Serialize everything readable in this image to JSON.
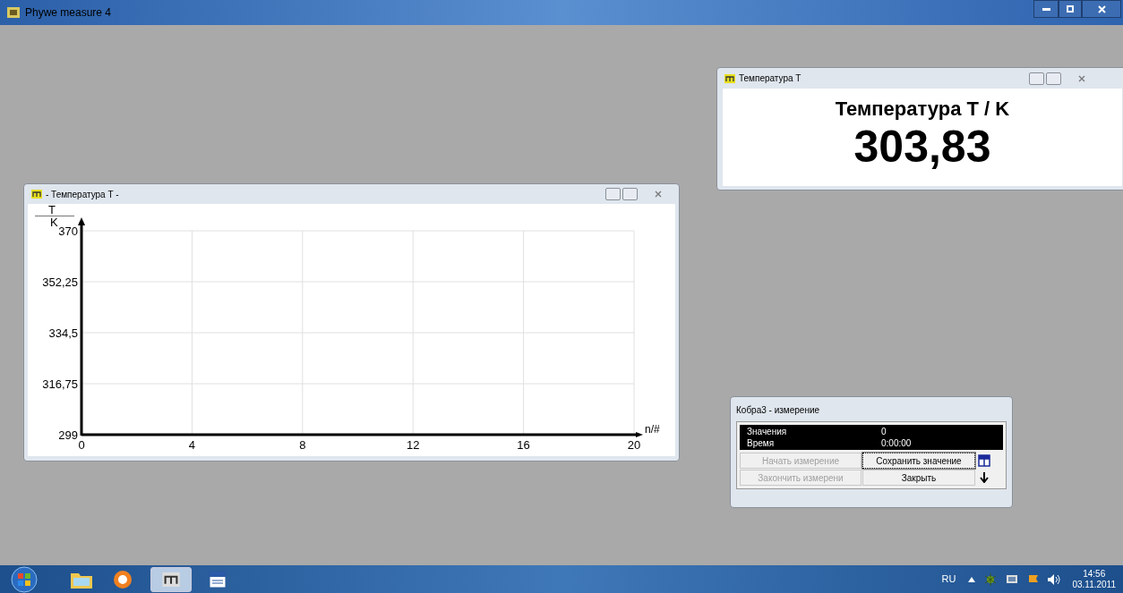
{
  "window": {
    "title": "Phywe measure 4"
  },
  "display_window": {
    "title": "Температура T",
    "heading": "Температура T / K",
    "value": "303,83"
  },
  "chart_window": {
    "title": "- Температура T -",
    "y_quantity": "T",
    "y_unit": "K",
    "chart_data": {
      "type": "line",
      "grid": true,
      "xlabel": "n/#",
      "xlim": [
        0,
        20
      ],
      "ylim": [
        299,
        370
      ],
      "xticks": [
        0,
        4,
        8,
        12,
        16,
        20
      ],
      "yticks": [
        {
          "value": 299,
          "label": "299"
        },
        {
          "value": 316.75,
          "label": "316,75"
        },
        {
          "value": 334.5,
          "label": "334,5"
        },
        {
          "value": 352.25,
          "label": "352,25"
        },
        {
          "value": 370,
          "label": "370"
        }
      ]
    }
  },
  "measure_window": {
    "title": "Кобра3 - измерение",
    "readouts": [
      {
        "label": "Значения",
        "value": "0"
      },
      {
        "label": "Время",
        "value": "0:00:00"
      }
    ],
    "buttons": [
      {
        "label": "Начать измерение",
        "disabled": true,
        "focused": false
      },
      {
        "label": "Сохранить значение",
        "disabled": false,
        "focused": true
      },
      {
        "label": "Закончить измерени",
        "disabled": true,
        "focused": false
      },
      {
        "label": "Закрыть",
        "disabled": false,
        "focused": false
      }
    ]
  },
  "taskbar": {
    "language": "RU",
    "time": "14:56",
    "date": "03.11.2011"
  }
}
